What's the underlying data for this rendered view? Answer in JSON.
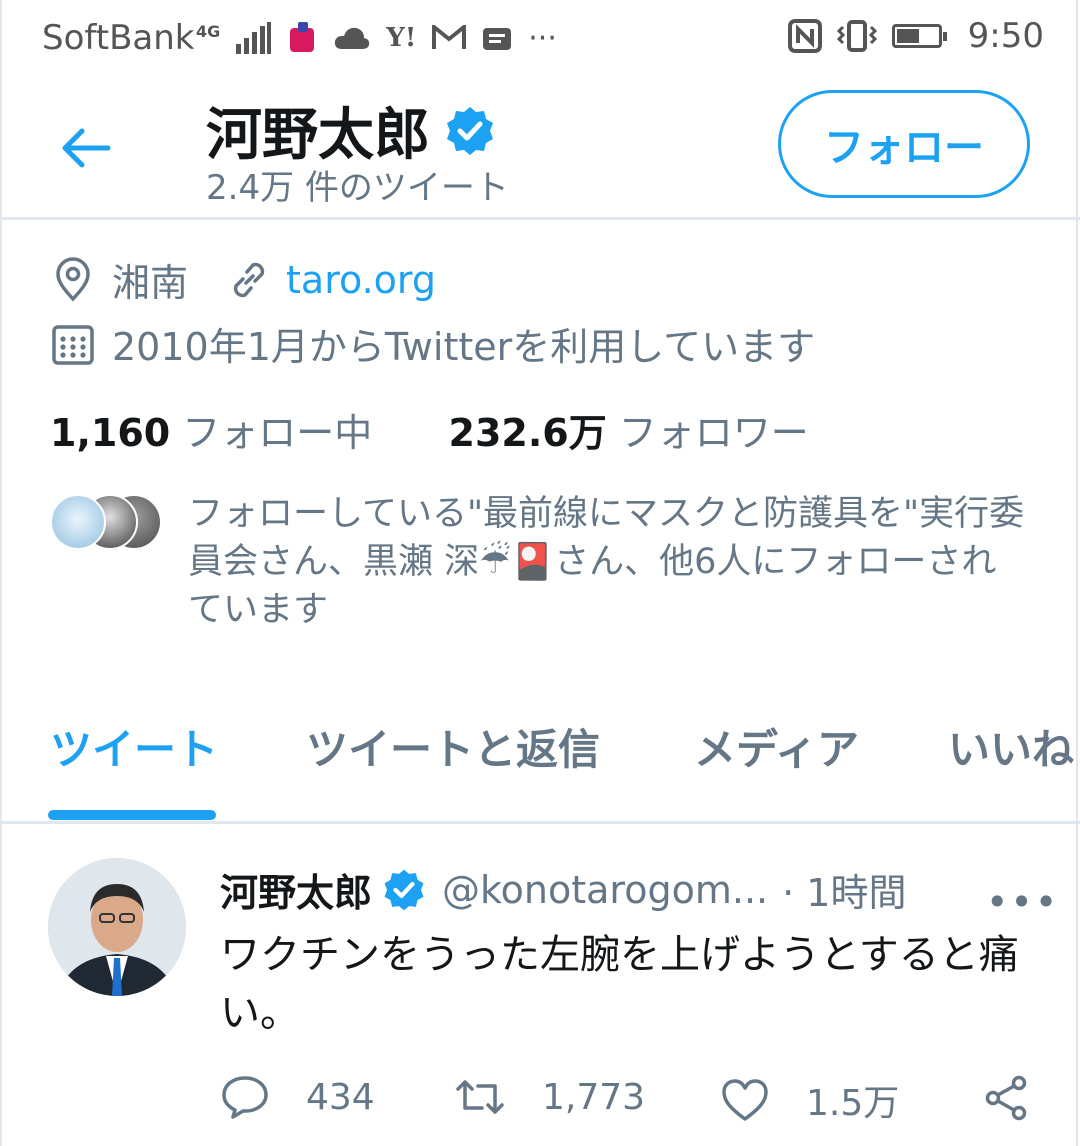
{
  "status_bar": {
    "carrier": "SoftBank",
    "network": "4G",
    "time": "9:50",
    "battery_level": 0.55
  },
  "header": {
    "name": "河野太郎",
    "tweet_count": "2.4万 件のツイート",
    "follow_label": "フォロー",
    "verified": true
  },
  "profile": {
    "location": "湘南",
    "website": "taro.org",
    "joined": "2010年1月からTwitterを利用しています",
    "following_count": "1,160",
    "following_label": "フォロー中",
    "followers_count": "232.6万",
    "followers_label": "フォロワー",
    "followers_you_know": "フォローしている\"最前線にマスクと防護具を\"実行委員会さん、黒瀬 深☔🎴さん、他6人にフォローされています"
  },
  "tabs": [
    {
      "label": "ツイート",
      "active": true
    },
    {
      "label": "ツイートと返信",
      "active": false
    },
    {
      "label": "メディア",
      "active": false
    },
    {
      "label": "いいね",
      "active": false
    }
  ],
  "tweet": {
    "name": "河野太郎",
    "handle": "@konotarogom...",
    "time": "· 1時間",
    "text": "ワクチンをうった左腕を上げようとすると痛い。",
    "replies": "434",
    "retweets": "1,773",
    "likes": "1.5万"
  },
  "colors": {
    "accent": "#1da1f2",
    "secondary_text": "#657786",
    "primary_text": "#14171a",
    "divider": "#e1e8ed"
  },
  "icons": [
    "back-arrow-icon",
    "verified-badge-icon",
    "location-icon",
    "link-icon",
    "calendar-icon",
    "more-icon",
    "reply-icon",
    "retweet-icon",
    "like-icon",
    "share-icon"
  ]
}
